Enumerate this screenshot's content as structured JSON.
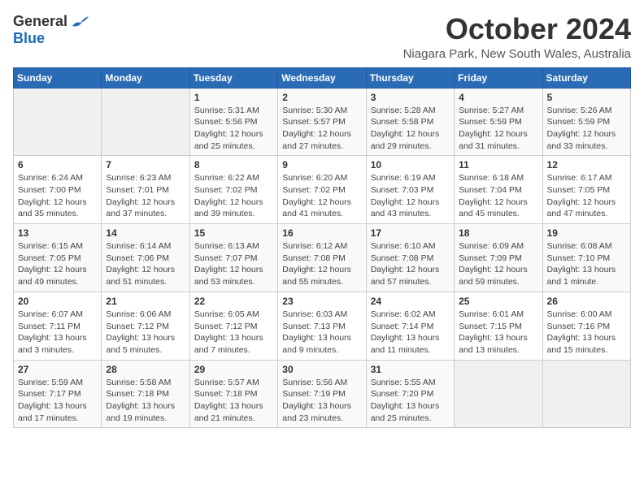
{
  "logo": {
    "general": "General",
    "blue": "Blue"
  },
  "title": "October 2024",
  "subtitle": "Niagara Park, New South Wales, Australia",
  "headers": [
    "Sunday",
    "Monday",
    "Tuesday",
    "Wednesday",
    "Thursday",
    "Friday",
    "Saturday"
  ],
  "weeks": [
    [
      null,
      null,
      {
        "day": 1,
        "sunrise": "5:31 AM",
        "sunset": "5:56 PM",
        "daylight": "12 hours and 25 minutes."
      },
      {
        "day": 2,
        "sunrise": "5:30 AM",
        "sunset": "5:57 PM",
        "daylight": "12 hours and 27 minutes."
      },
      {
        "day": 3,
        "sunrise": "5:28 AM",
        "sunset": "5:58 PM",
        "daylight": "12 hours and 29 minutes."
      },
      {
        "day": 4,
        "sunrise": "5:27 AM",
        "sunset": "5:59 PM",
        "daylight": "12 hours and 31 minutes."
      },
      {
        "day": 5,
        "sunrise": "5:26 AM",
        "sunset": "5:59 PM",
        "daylight": "12 hours and 33 minutes."
      }
    ],
    [
      {
        "day": 6,
        "sunrise": "6:24 AM",
        "sunset": "7:00 PM",
        "daylight": "12 hours and 35 minutes."
      },
      {
        "day": 7,
        "sunrise": "6:23 AM",
        "sunset": "7:01 PM",
        "daylight": "12 hours and 37 minutes."
      },
      {
        "day": 8,
        "sunrise": "6:22 AM",
        "sunset": "7:02 PM",
        "daylight": "12 hours and 39 minutes."
      },
      {
        "day": 9,
        "sunrise": "6:20 AM",
        "sunset": "7:02 PM",
        "daylight": "12 hours and 41 minutes."
      },
      {
        "day": 10,
        "sunrise": "6:19 AM",
        "sunset": "7:03 PM",
        "daylight": "12 hours and 43 minutes."
      },
      {
        "day": 11,
        "sunrise": "6:18 AM",
        "sunset": "7:04 PM",
        "daylight": "12 hours and 45 minutes."
      },
      {
        "day": 12,
        "sunrise": "6:17 AM",
        "sunset": "7:05 PM",
        "daylight": "12 hours and 47 minutes."
      }
    ],
    [
      {
        "day": 13,
        "sunrise": "6:15 AM",
        "sunset": "7:05 PM",
        "daylight": "12 hours and 49 minutes."
      },
      {
        "day": 14,
        "sunrise": "6:14 AM",
        "sunset": "7:06 PM",
        "daylight": "12 hours and 51 minutes."
      },
      {
        "day": 15,
        "sunrise": "6:13 AM",
        "sunset": "7:07 PM",
        "daylight": "12 hours and 53 minutes."
      },
      {
        "day": 16,
        "sunrise": "6:12 AM",
        "sunset": "7:08 PM",
        "daylight": "12 hours and 55 minutes."
      },
      {
        "day": 17,
        "sunrise": "6:10 AM",
        "sunset": "7:08 PM",
        "daylight": "12 hours and 57 minutes."
      },
      {
        "day": 18,
        "sunrise": "6:09 AM",
        "sunset": "7:09 PM",
        "daylight": "12 hours and 59 minutes."
      },
      {
        "day": 19,
        "sunrise": "6:08 AM",
        "sunset": "7:10 PM",
        "daylight": "13 hours and 1 minute."
      }
    ],
    [
      {
        "day": 20,
        "sunrise": "6:07 AM",
        "sunset": "7:11 PM",
        "daylight": "13 hours and 3 minutes."
      },
      {
        "day": 21,
        "sunrise": "6:06 AM",
        "sunset": "7:12 PM",
        "daylight": "13 hours and 5 minutes."
      },
      {
        "day": 22,
        "sunrise": "6:05 AM",
        "sunset": "7:12 PM",
        "daylight": "13 hours and 7 minutes."
      },
      {
        "day": 23,
        "sunrise": "6:03 AM",
        "sunset": "7:13 PM",
        "daylight": "13 hours and 9 minutes."
      },
      {
        "day": 24,
        "sunrise": "6:02 AM",
        "sunset": "7:14 PM",
        "daylight": "13 hours and 11 minutes."
      },
      {
        "day": 25,
        "sunrise": "6:01 AM",
        "sunset": "7:15 PM",
        "daylight": "13 hours and 13 minutes."
      },
      {
        "day": 26,
        "sunrise": "6:00 AM",
        "sunset": "7:16 PM",
        "daylight": "13 hours and 15 minutes."
      }
    ],
    [
      {
        "day": 27,
        "sunrise": "5:59 AM",
        "sunset": "7:17 PM",
        "daylight": "13 hours and 17 minutes."
      },
      {
        "day": 28,
        "sunrise": "5:58 AM",
        "sunset": "7:18 PM",
        "daylight": "13 hours and 19 minutes."
      },
      {
        "day": 29,
        "sunrise": "5:57 AM",
        "sunset": "7:18 PM",
        "daylight": "13 hours and 21 minutes."
      },
      {
        "day": 30,
        "sunrise": "5:56 AM",
        "sunset": "7:19 PM",
        "daylight": "13 hours and 23 minutes."
      },
      {
        "day": 31,
        "sunrise": "5:55 AM",
        "sunset": "7:20 PM",
        "daylight": "13 hours and 25 minutes."
      },
      null,
      null
    ]
  ],
  "labels": {
    "sunrise": "Sunrise:",
    "sunset": "Sunset:",
    "daylight": "Daylight:"
  }
}
